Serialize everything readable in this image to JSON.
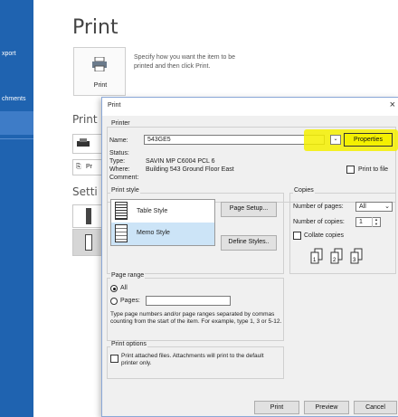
{
  "backstage": {
    "nav": {
      "export": "xport",
      "attachments": "chments"
    },
    "title": "Print",
    "print_tile_label": "Print",
    "print_description": "Specify how you want the item to be printed and then click Print.",
    "printer_heading": "Print",
    "settings_heading": "Setti",
    "printer_button_partial": "Pr"
  },
  "dialog": {
    "title": "Print",
    "close": "×",
    "printer": {
      "group": "Printer",
      "name_label": "Name:",
      "name_value": "543GE5",
      "status_label": "Status:",
      "type_label": "Type:",
      "type_value": "SAVIN MP C6004 PCL 6",
      "where_label": "Where:",
      "where_value": "Building 543 Ground Floor East",
      "comment_label": "Comment:",
      "properties_button": "Properties",
      "print_to_file": "Print to file"
    },
    "print_style": {
      "group": "Print style",
      "styles": [
        "Table Style",
        "Memo Style"
      ],
      "selected": "Memo Style",
      "page_setup_button": "Page Setup...",
      "define_styles_button": "Define Styles.."
    },
    "copies": {
      "group": "Copies",
      "pages_label": "Number of pages:",
      "pages_value": "All",
      "copies_label": "Number of copies:",
      "copies_value": "1",
      "collate": "Collate copies"
    },
    "page_range": {
      "group": "Page range",
      "all": "All",
      "pages": "Pages:",
      "help": "Type page numbers and/or page ranges separated by commas counting from the start of the item.  For example, type 1, 3 or 5-12."
    },
    "print_options": {
      "group": "Print options",
      "attached": "Print attached files.  Attachments will print to the default printer only."
    },
    "buttons": {
      "print": "Print",
      "preview": "Preview",
      "cancel": "Cancel"
    }
  },
  "colors": {
    "rail": "#1f63b0",
    "highlight": "#f4f000",
    "selection": "#cce4f7"
  }
}
